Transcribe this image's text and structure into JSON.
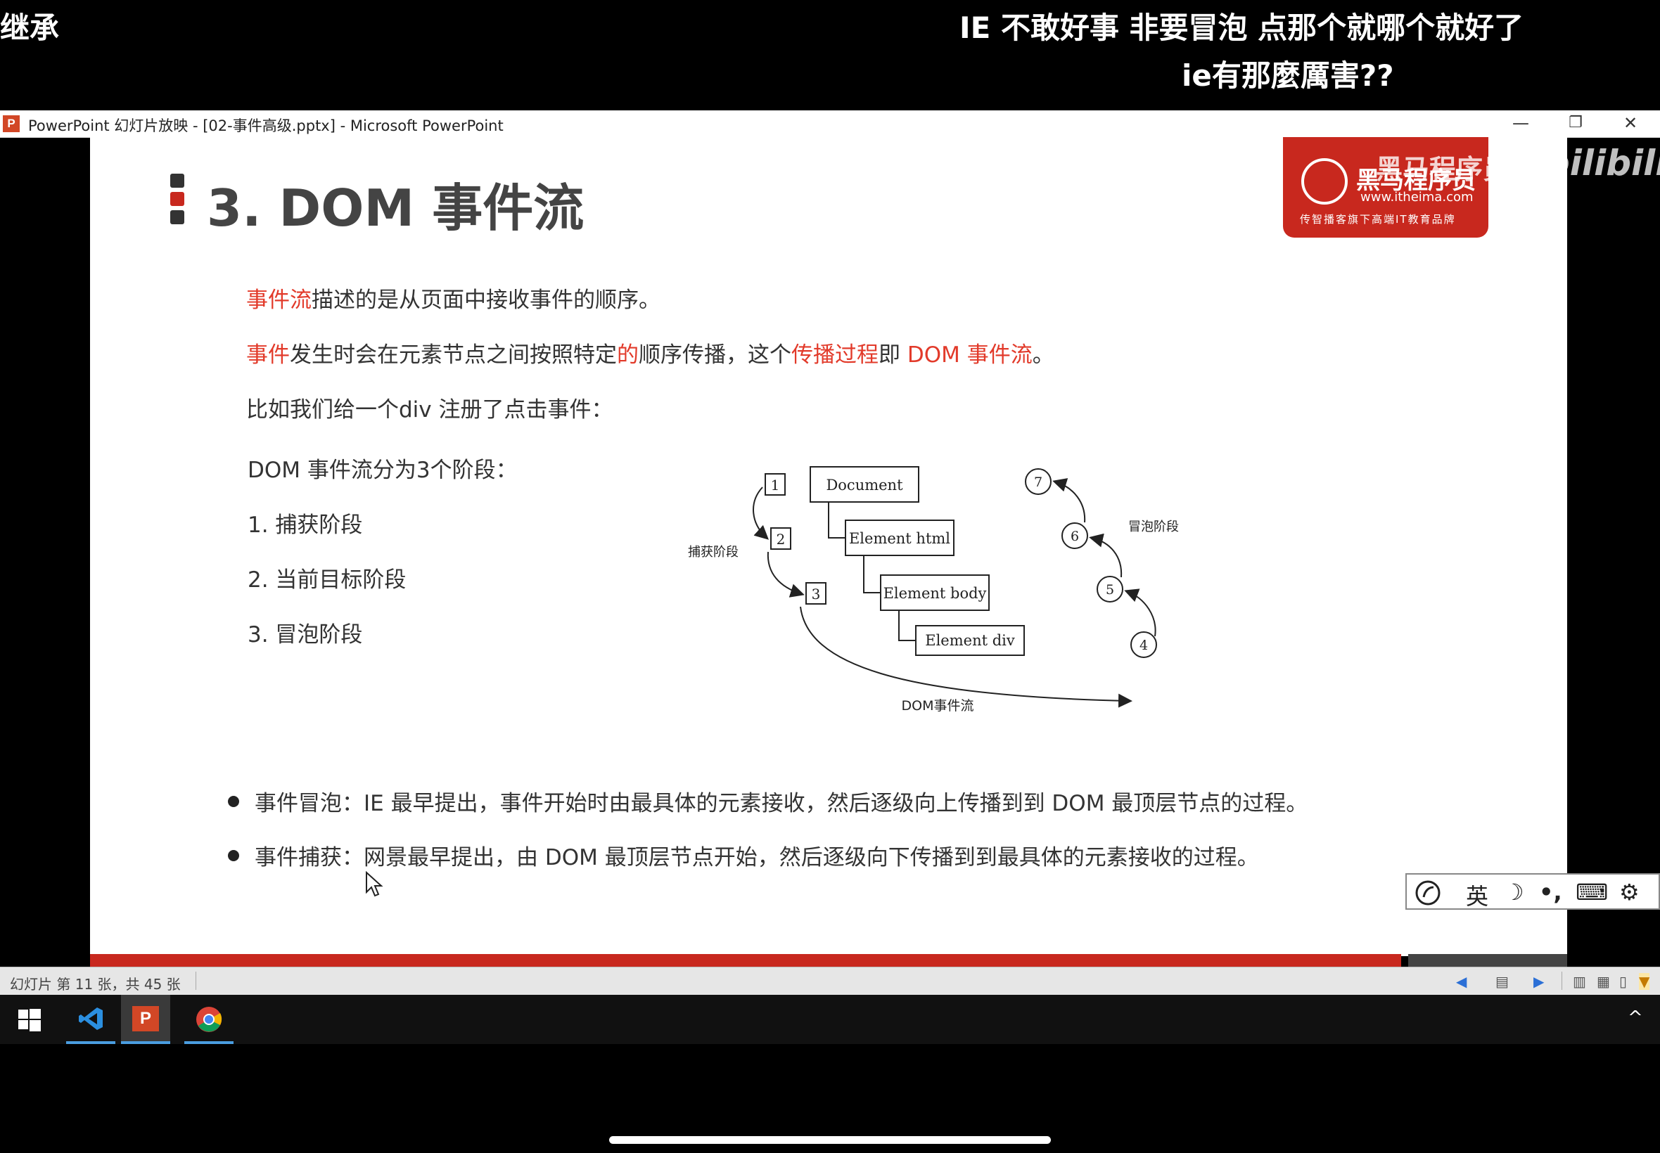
{
  "danmaku": [
    "继承",
    "IE 不敢好事 非要冒泡  点那个就哪个就好了",
    "ie有那麼厲害??"
  ],
  "window": {
    "app_icon_letter": "P",
    "title": "PowerPoint 幻灯片放映 - [02-事件高级.pptx] - Microsoft PowerPoint",
    "minimize": "—",
    "restore": "❐",
    "close": "✕"
  },
  "slide": {
    "title": "3. DOM 事件流",
    "line1": {
      "red": "事件流",
      "rest": "描述的是从页面中接收事件的顺序。"
    },
    "line2": {
      "p1": "事件",
      "p2": "发生时会在元素节点之间按照特定",
      "p3": "的",
      "p4": "顺序传播，这个",
      "p5": "传播过程",
      "p6": "即 ",
      "p7": "DOM 事件流",
      "p8": "。"
    },
    "line3": "比如我们给一个div 注册了点击事件：",
    "phases_heading": "DOM 事件流分为3个阶段：",
    "phases": [
      "1. 捕获阶段",
      "2. 当前目标阶段",
      "3. 冒泡阶段"
    ],
    "bullets": [
      "事件冒泡：IE 最早提出，事件开始时由最具体的元素接收，然后逐级向上传播到到 DOM 最顶层节点的过程。",
      "事件捕获：网景最早提出，由 DOM 最顶层节点开始，然后逐级向下传播到到最具体的元素接收的过程。"
    ]
  },
  "diagram": {
    "nodes": [
      "Document",
      "Element html",
      "Element body",
      "Element div"
    ],
    "capture_steps": [
      "1",
      "2",
      "3"
    ],
    "bubble_steps": [
      "7",
      "6",
      "5",
      "4"
    ],
    "capture_label": "捕获阶段",
    "bubble_label": "冒泡阶段",
    "caption": "DOM事件流"
  },
  "logo": {
    "name": "黑马程序员",
    "url": "www.itheima.com",
    "slogan": "传智播客旗下高端IT教育品牌"
  },
  "watermark": {
    "brand": "黑马程序员-",
    "site": "bilibili"
  },
  "ime": {
    "lang": "英",
    "moon": "☽",
    "punct": "•,",
    "keyboard": "⌨",
    "settings": "⚙"
  },
  "status": {
    "slide_info": "幻灯片 第 11 张，共 45 张"
  },
  "taskbar": {
    "apps": [
      "start",
      "vscode",
      "powerpoint",
      "chrome"
    ],
    "tray_chevron": "^"
  }
}
